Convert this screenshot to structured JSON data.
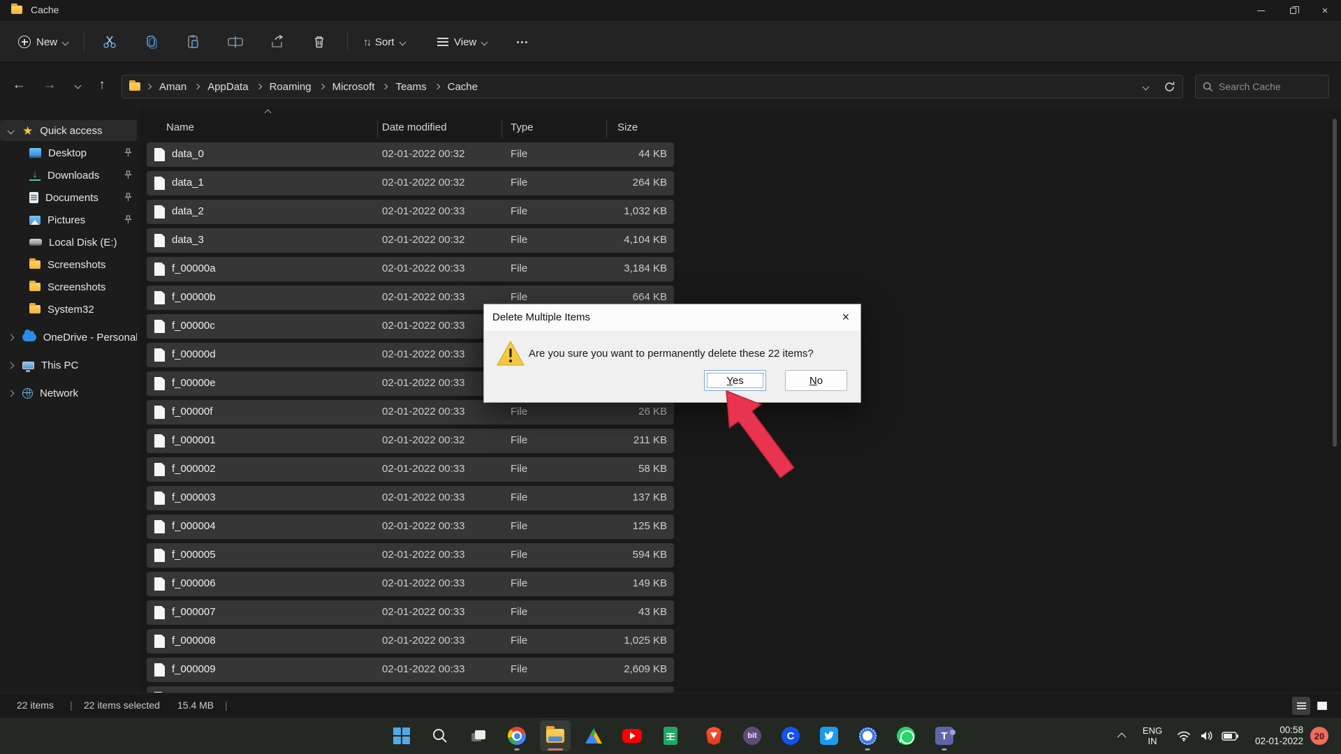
{
  "window": {
    "title": "Cache"
  },
  "toolbar": {
    "new_label": "New",
    "sort_label": "Sort",
    "view_label": "View"
  },
  "breadcrumb": {
    "segments": [
      "Aman",
      "AppData",
      "Roaming",
      "Microsoft",
      "Teams",
      "Cache"
    ]
  },
  "search": {
    "placeholder": "Search Cache"
  },
  "sidebar": {
    "quick_access_label": "Quick access",
    "pinned": [
      {
        "label": "Desktop"
      },
      {
        "label": "Downloads"
      },
      {
        "label": "Documents"
      },
      {
        "label": "Pictures"
      },
      {
        "label": "Local Disk (E:)"
      },
      {
        "label": "Screenshots"
      },
      {
        "label": "Screenshots"
      },
      {
        "label": "System32"
      }
    ],
    "roots": [
      {
        "label": "OneDrive - Personal"
      },
      {
        "label": "This PC"
      },
      {
        "label": "Network"
      }
    ]
  },
  "list": {
    "columns": {
      "name": "Name",
      "date": "Date modified",
      "type": "Type",
      "size": "Size"
    },
    "files": [
      {
        "name": "data_0",
        "date": "02-01-2022 00:32",
        "type": "File",
        "size": "44 KB"
      },
      {
        "name": "data_1",
        "date": "02-01-2022 00:32",
        "type": "File",
        "size": "264 KB"
      },
      {
        "name": "data_2",
        "date": "02-01-2022 00:33",
        "type": "File",
        "size": "1,032 KB"
      },
      {
        "name": "data_3",
        "date": "02-01-2022 00:32",
        "type": "File",
        "size": "4,104 KB"
      },
      {
        "name": "f_00000a",
        "date": "02-01-2022 00:33",
        "type": "File",
        "size": "3,184 KB"
      },
      {
        "name": "f_00000b",
        "date": "02-01-2022 00:33",
        "type": "File",
        "size": "664 KB"
      },
      {
        "name": "f_00000c",
        "date": "02-01-2022 00:33",
        "type": "",
        "size": ""
      },
      {
        "name": "f_00000d",
        "date": "02-01-2022 00:33",
        "type": "",
        "size": ""
      },
      {
        "name": "f_00000e",
        "date": "02-01-2022 00:33",
        "type": "",
        "size": ""
      },
      {
        "name": "f_00000f",
        "date": "02-01-2022 00:33",
        "type": "File",
        "size": "26 KB"
      },
      {
        "name": "f_000001",
        "date": "02-01-2022 00:32",
        "type": "File",
        "size": "211 KB"
      },
      {
        "name": "f_000002",
        "date": "02-01-2022 00:33",
        "type": "File",
        "size": "58 KB"
      },
      {
        "name": "f_000003",
        "date": "02-01-2022 00:33",
        "type": "File",
        "size": "137 KB"
      },
      {
        "name": "f_000004",
        "date": "02-01-2022 00:33",
        "type": "File",
        "size": "125 KB"
      },
      {
        "name": "f_000005",
        "date": "02-01-2022 00:33",
        "type": "File",
        "size": "594 KB"
      },
      {
        "name": "f_000006",
        "date": "02-01-2022 00:33",
        "type": "File",
        "size": "149 KB"
      },
      {
        "name": "f_000007",
        "date": "02-01-2022 00:33",
        "type": "File",
        "size": "43 KB"
      },
      {
        "name": "f_000008",
        "date": "02-01-2022 00:33",
        "type": "File",
        "size": "1,025 KB"
      },
      {
        "name": "f_000009",
        "date": "02-01-2022 00:33",
        "type": "File",
        "size": "2,609 KB"
      }
    ]
  },
  "status": {
    "items_count": "22 items",
    "divider": "|",
    "selected": "22 items selected",
    "selected_size": "15.4 MB"
  },
  "dialog": {
    "title": "Delete Multiple Items",
    "message": "Are you sure you want to permanently delete these 22 items?",
    "yes_label": "Yes",
    "no_label": "No",
    "close_glyph": "×"
  },
  "taskbar": {
    "bit_label": "bit",
    "coinbase_label": "C",
    "teams_label": "T",
    "tray": {
      "lang_line1": "ENG",
      "lang_line2": "IN",
      "time": "00:58",
      "date": "02-01-2022",
      "badge_count": "20"
    }
  },
  "colors": {
    "selection_row": "#363636",
    "folder_yellow": "#f5b53d",
    "warning_yellow": "#f6c93e",
    "annotation_arrow_red": "#e8344e",
    "badge_red": "#ef6c5e",
    "default_button_focus": "#7da7d8"
  }
}
